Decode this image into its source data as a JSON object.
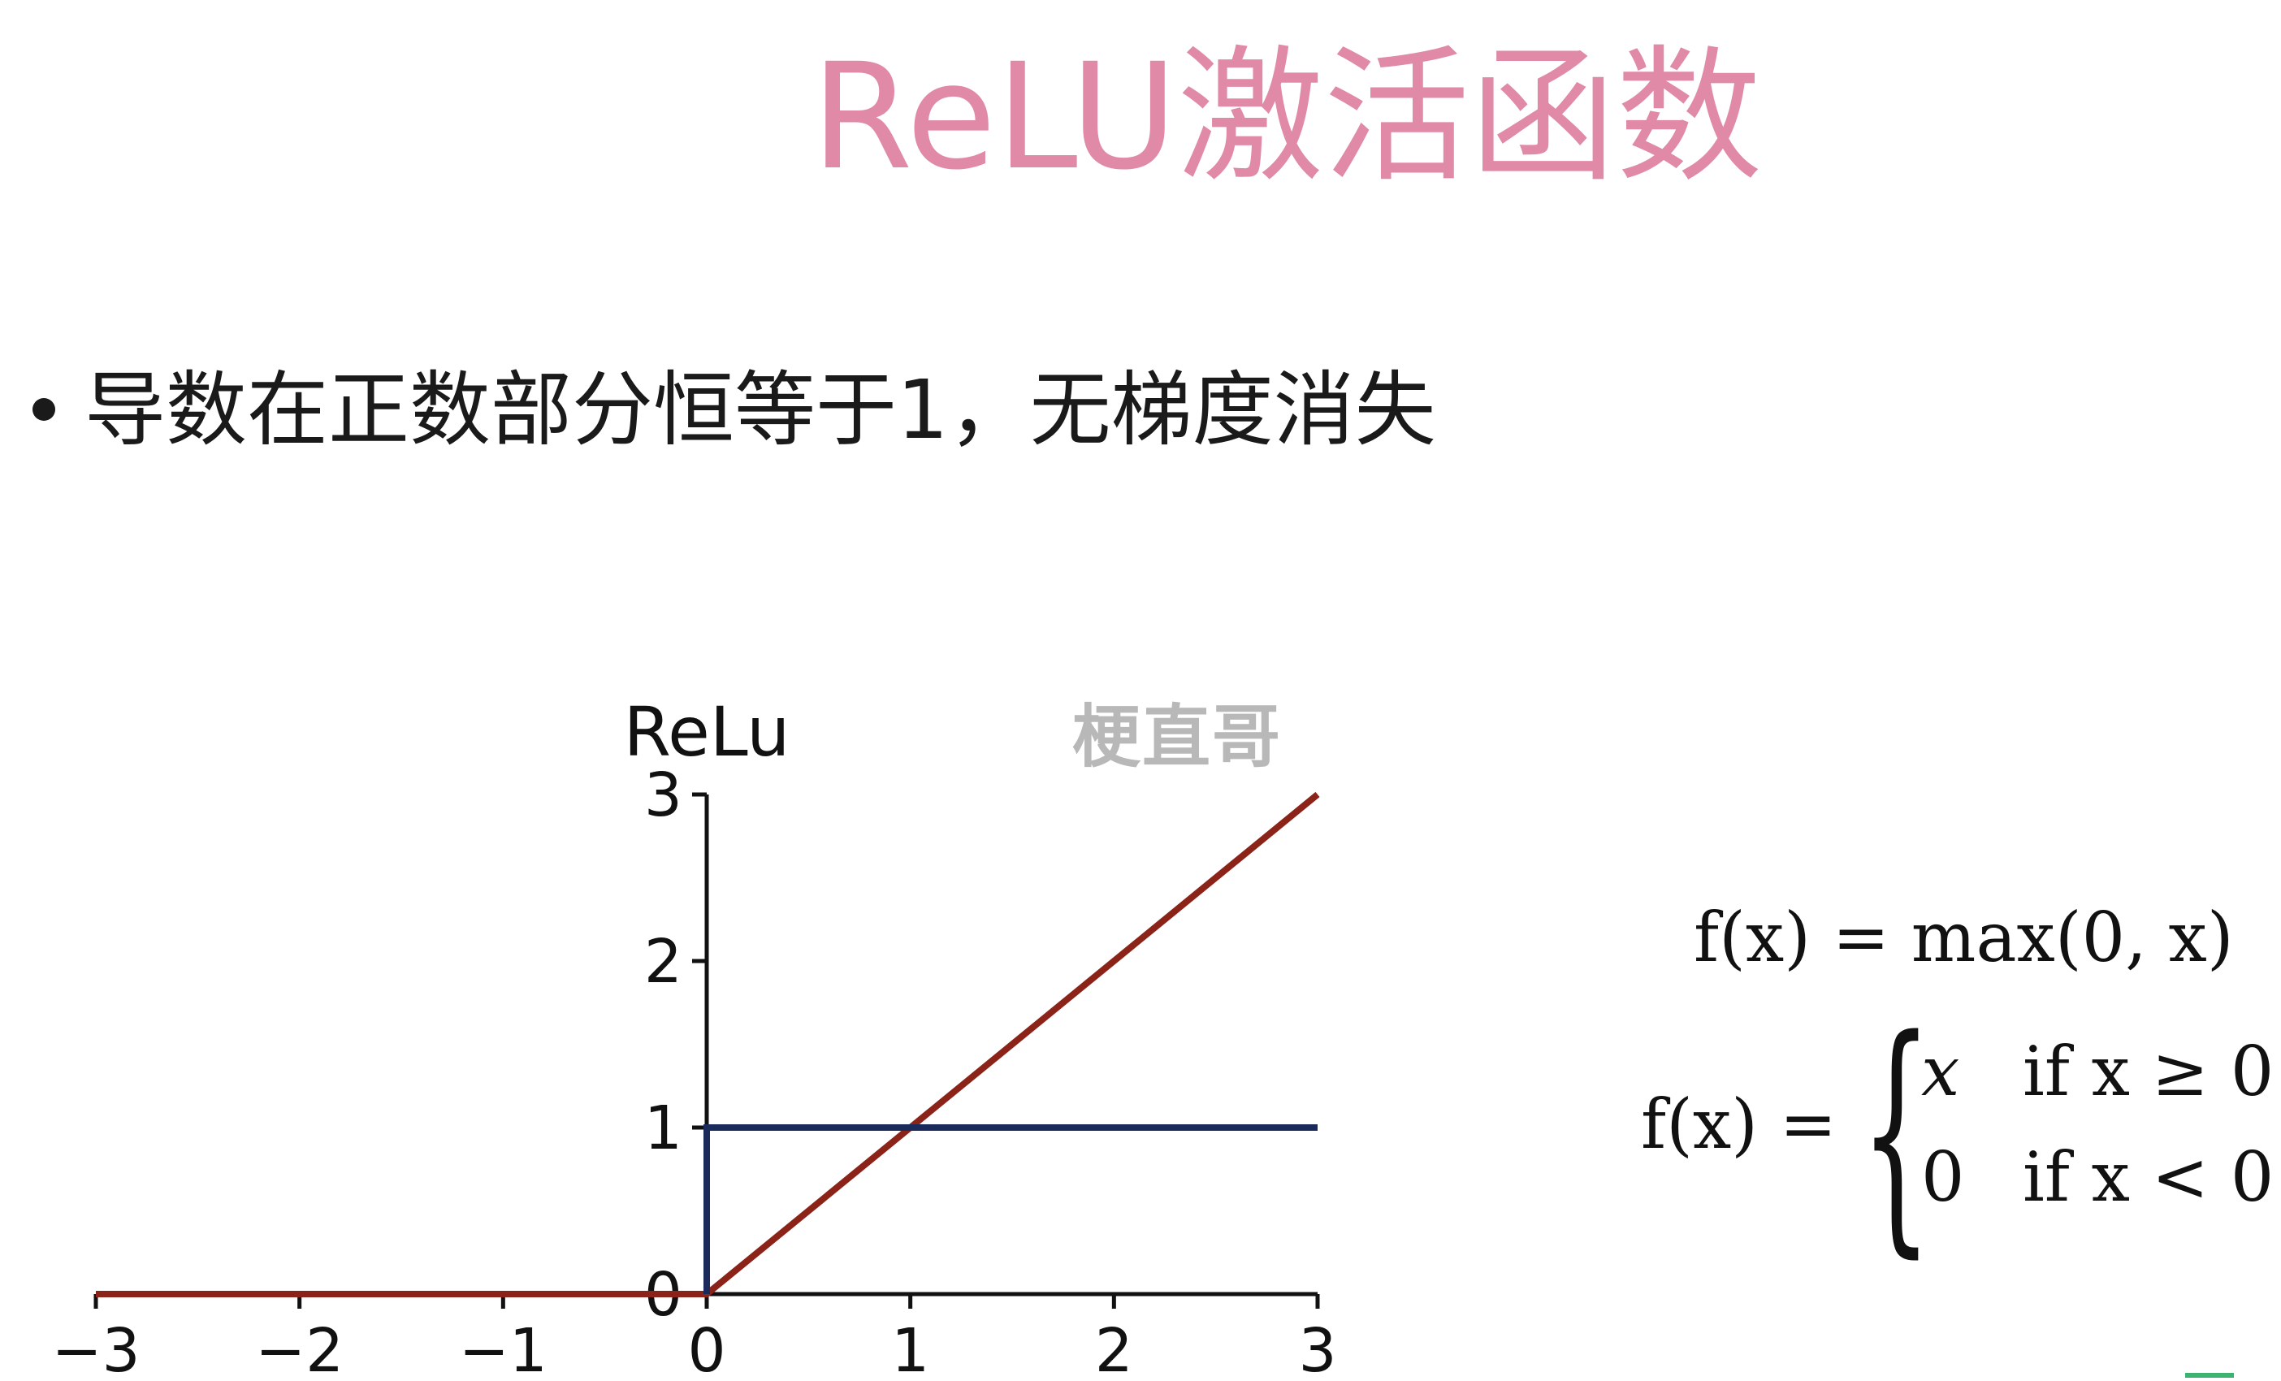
{
  "slide": {
    "title": "ReLU激活函数",
    "bullet": "导数在正数部分恒等于1，无梯度消失",
    "watermark": "梗直哥"
  },
  "formulas": {
    "max_form": "f(x) = max(0, x)",
    "piecewise_lhs": "f(x) =",
    "case1_expr": "x",
    "case1_cond": "if x ≥ 0",
    "case2_expr": "0",
    "case2_cond": "if x < 0"
  },
  "chart_data": {
    "type": "line",
    "title": "ReLu",
    "xlim": [
      -3,
      3
    ],
    "ylim": [
      0,
      3
    ],
    "x_ticks": [
      "−3",
      "−2",
      "−1",
      "0",
      "1",
      "2",
      "3"
    ],
    "y_ticks": [
      "0",
      "1",
      "2",
      "3"
    ],
    "grid": false,
    "series": [
      {
        "color": "#8b2318",
        "points": [
          [
            -3,
            0
          ],
          [
            0,
            0
          ],
          [
            3,
            3
          ]
        ]
      },
      {
        "color": "#1a2a5a",
        "points": [
          [
            0,
            0
          ],
          [
            0,
            1
          ],
          [
            3,
            1
          ]
        ]
      }
    ]
  }
}
